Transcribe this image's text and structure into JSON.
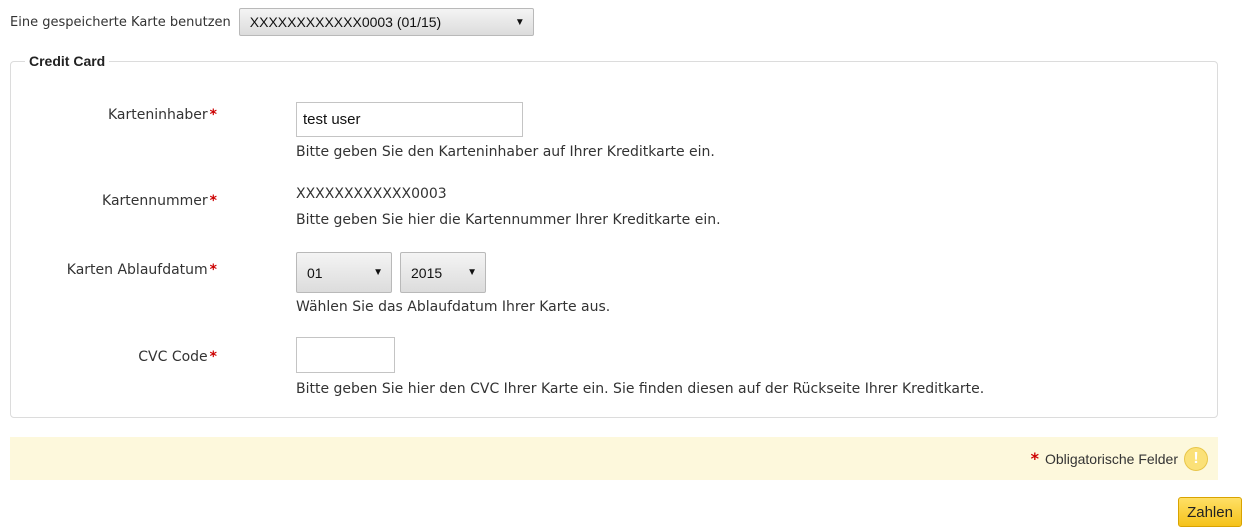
{
  "saved_card": {
    "label": "Eine gespeicherte Karte benutzen",
    "selected": "XXXXXXXXXXXX0003 (01/15)"
  },
  "credit_card": {
    "legend": "Credit Card",
    "required_mark": "*",
    "holder": {
      "label": "Karteninhaber",
      "value": "test user",
      "hint": "Bitte geben Sie den Karteninhaber auf Ihrer Kreditkarte ein."
    },
    "number": {
      "label": "Kartennummer",
      "value": "XXXXXXXXXXXX0003",
      "hint": "Bitte geben Sie hier die Kartennummer Ihrer Kreditkarte ein."
    },
    "expiry": {
      "label": "Karten Ablaufdatum",
      "month": "01",
      "year": "2015",
      "hint": "Wählen Sie das Ablaufdatum Ihrer Karte aus."
    },
    "cvc": {
      "label": "CVC Code",
      "value": "",
      "hint": "Bitte geben Sie hier den CVC Ihrer Karte ein. Sie finden diesen auf der Rückseite Ihrer Kreditkarte."
    }
  },
  "required_note": {
    "mark": "*",
    "text": "Obligatorische Felder",
    "icon": "warning-icon",
    "icon_glyph": "!"
  },
  "submit": {
    "label": "Zahlen"
  },
  "colors": {
    "required": "#cc0000",
    "note_background": "#fdf8dc",
    "button": "#f5c21a"
  }
}
